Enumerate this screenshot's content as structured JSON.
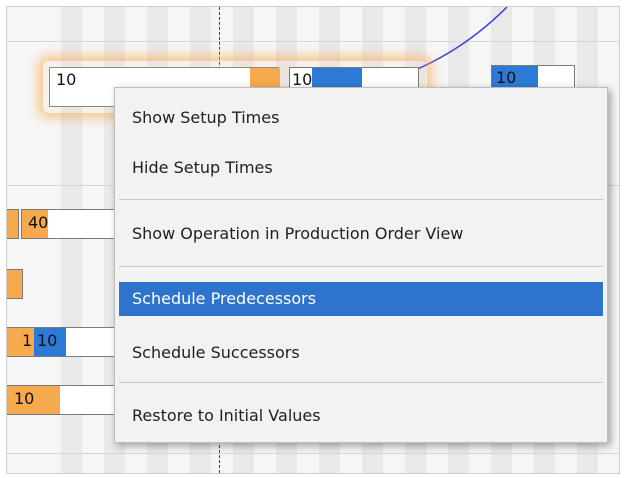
{
  "gantt": {
    "selected_bar": {
      "label": "10"
    },
    "bar_top_middle": {
      "label": "10"
    },
    "bar_top_right": {
      "label": "10"
    },
    "bar_row1": {
      "label": "40"
    },
    "bar_row3a": {
      "label": "1"
    },
    "bar_row3b": {
      "label": "10"
    },
    "bar_row4": {
      "label": "10"
    }
  },
  "menu": {
    "items": [
      {
        "label": "Show Setup Times"
      },
      {
        "label": "Hide Setup Times"
      },
      {
        "label": "Show Operation in Production Order View"
      },
      {
        "label": "Schedule Predecessors"
      },
      {
        "label": "Schedule Successors"
      },
      {
        "label": "Restore to Initial Values"
      }
    ],
    "highlighted_index": 3
  },
  "colors": {
    "setup_orange": "#f7a94d",
    "operation_blue": "#2c7ad5",
    "menu_highlight": "#2e74cc",
    "link_curve": "#3a3ae0"
  }
}
